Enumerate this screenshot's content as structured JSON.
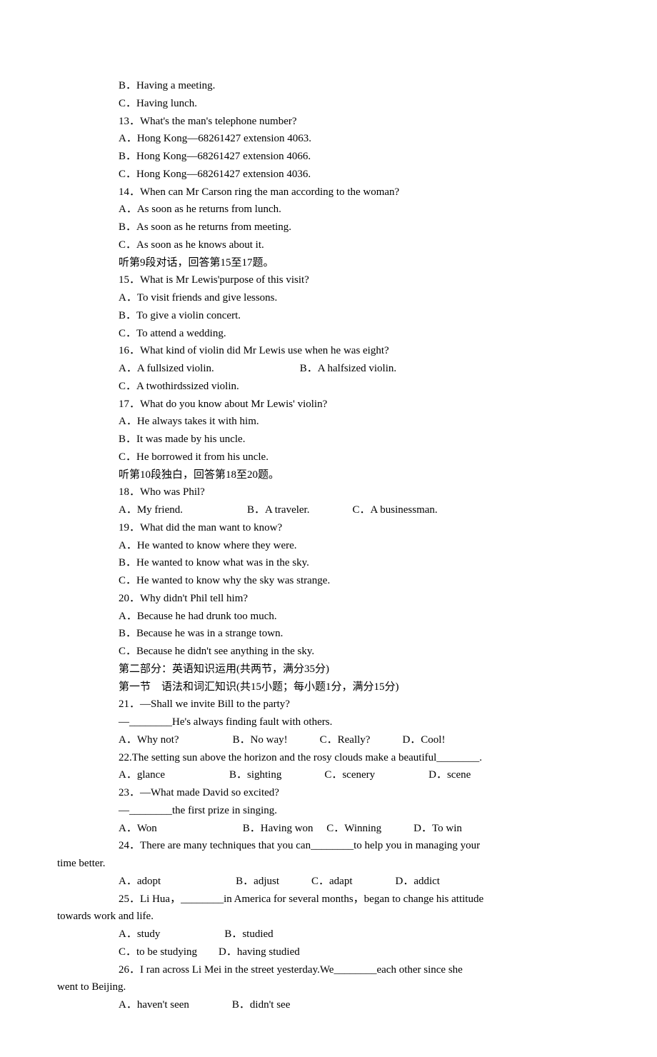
{
  "lines": [
    {
      "cls": "indent",
      "t": "B．Having a meeting."
    },
    {
      "cls": "indent",
      "t": "C．Having lunch."
    },
    {
      "cls": "indent",
      "t": "13．What's the man's telephone number?"
    },
    {
      "cls": "indent",
      "t": "A．Hong Kong—68261427 extension 4063."
    },
    {
      "cls": "indent",
      "t": "B．Hong Kong—68261427 extension 4066."
    },
    {
      "cls": "indent",
      "t": "C．Hong Kong—68261427 extension 4036."
    },
    {
      "cls": "indent",
      "t": "14．When can Mr Carson ring the man according to the woman?"
    },
    {
      "cls": "indent",
      "t": "A．As soon as he returns from lunch."
    },
    {
      "cls": "indent",
      "t": "B．As soon as he returns from meeting."
    },
    {
      "cls": "indent",
      "t": "C．As soon as he knows about it."
    },
    {
      "cls": "indent",
      "t": "听第9段对话，回答第15至17题。"
    },
    {
      "cls": "indent",
      "t": "15．What is Mr Lewis'purpose of this visit?"
    },
    {
      "cls": "indent",
      "t": "A．To visit friends and give lessons."
    },
    {
      "cls": "indent",
      "t": "B．To give a violin concert."
    },
    {
      "cls": "indent",
      "t": "C．To attend a wedding."
    },
    {
      "cls": "indent",
      "t": "16．What kind of violin did Mr Lewis use when he was eight?"
    },
    {
      "cls": "indent",
      "t": "A．A full­sized violin.　　　　　　　　B．A half­sized violin."
    },
    {
      "cls": "indent",
      "t": "C．A two­thirds­sized violin."
    },
    {
      "cls": "indent",
      "t": "17．What do you know about Mr Lewis' violin?"
    },
    {
      "cls": "indent",
      "t": "A．He always takes it with him."
    },
    {
      "cls": "indent",
      "t": "B．It was made by his uncle."
    },
    {
      "cls": "indent",
      "t": "C．He borrowed it from his uncle."
    },
    {
      "cls": "indent",
      "t": "听第10段独白，回答第18至20题。"
    },
    {
      "cls": "indent",
      "t": "18．Who was Phil?"
    },
    {
      "cls": "indent",
      "t": "A．My friend.　　　　　　B．A traveler.　　　　C．A businessman."
    },
    {
      "cls": "indent",
      "t": "19．What did the man want to know?"
    },
    {
      "cls": "indent",
      "t": "A．He wanted to know where they were."
    },
    {
      "cls": "indent",
      "t": "B．He wanted to know what was in the sky."
    },
    {
      "cls": "indent",
      "t": "C．He wanted to know why the sky was strange."
    },
    {
      "cls": "indent",
      "t": "20．Why didn't Phil tell him?"
    },
    {
      "cls": "indent",
      "t": "A．Because he had drunk too much."
    },
    {
      "cls": "indent",
      "t": "B．Because he was in a strange town."
    },
    {
      "cls": "indent",
      "t": "C．Because he didn't see anything in the sky."
    },
    {
      "cls": "indent",
      "t": "第二部分：英语知识运用(共两节，满分35分)"
    },
    {
      "cls": "indent",
      "t": "第一节　语法和词汇知识(共15小题；每小题1分，满分15分)"
    },
    {
      "cls": "indent",
      "t": "21．—Shall we invite Bill to the party?"
    },
    {
      "cls": "indent",
      "t": "—________He's always finding fault with others."
    },
    {
      "cls": "indent",
      "t": "A．Why not?　　　　　B．No way!　　　C．Really?　　　D．Cool!"
    },
    {
      "cls": "indent",
      "t": "22.The setting sun above the horizon and the rosy clouds make a beautiful________."
    },
    {
      "cls": "indent",
      "t": "A．glance　　　　　　B．sighting　　　　C．scenery　　　　　D．scene"
    },
    {
      "cls": "indent",
      "t": "23．—What made David so excited?"
    },
    {
      "cls": "indent",
      "t": "—________the first prize in singing."
    },
    {
      "cls": "indent",
      "t": "A．Won　　　　　　　　B．Having won　 C．Winning　　　D．To win"
    },
    {
      "cls": "indent",
      "t": "24．There are many techniques that you can________to help you in managing your"
    },
    {
      "cls": "no-indent",
      "t": "time better."
    },
    {
      "cls": "indent",
      "t": "A．adopt　　　　　　　B．adjust　　　C．adapt　　　　D．addict"
    },
    {
      "cls": "indent",
      "t": "25．Li Hua，________in America for several months，began to change his attitude"
    },
    {
      "cls": "no-indent",
      "t": "towards work and life."
    },
    {
      "cls": "indent",
      "t": "A．study　　　　　　B．studied"
    },
    {
      "cls": "indent",
      "t": "C．to be studying　　D．having studied"
    },
    {
      "cls": "indent",
      "t": "26．I ran across Li Mei in the street yesterday.We________each other since she"
    },
    {
      "cls": "no-indent",
      "t": "went to Beijing."
    },
    {
      "cls": "indent",
      "t": "A．haven't seen　　　　B．didn't see"
    }
  ]
}
